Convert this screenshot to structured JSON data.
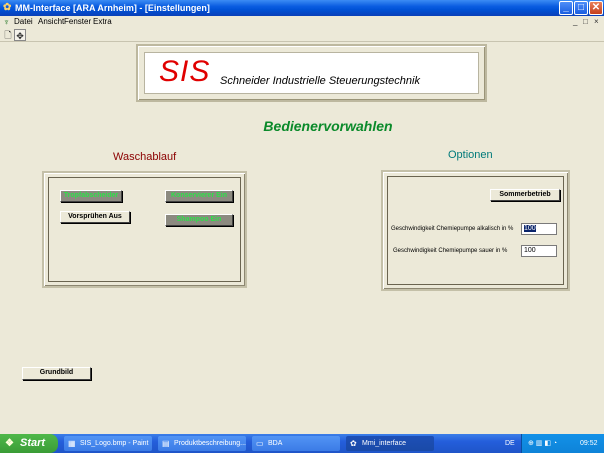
{
  "window": {
    "title": "MM-Interface [ARA Arnheim] - [Einstellungen]",
    "controls": {
      "minimize": "_",
      "maximize": "□",
      "close": "✕"
    }
  },
  "menu": {
    "items": [
      "Datei",
      "Ansicht",
      "Fenster",
      "Extra"
    ],
    "mdi_controls": [
      "_",
      "□",
      "×"
    ]
  },
  "toolbar": {
    "icons": [
      "new-document-icon",
      "navigate-icon"
    ]
  },
  "logo": {
    "brand": "SIS",
    "tagline": "Schneider Industrielle Steuerungstechnik",
    "brand_color": "#e00000"
  },
  "heading": "Bedienervorwahlen",
  "left_section": {
    "title": "Waschablauf",
    "buttons": {
      "tropfenabscheider": "Tropfabscheider",
      "vorspruehen": "Vorsprühen Aus",
      "konservierer": "Konservierer Ein",
      "shampoo": "Shampoo Ein"
    }
  },
  "right_section": {
    "title": "Optionen",
    "sommerbetrieb": "Sommerbetrieb",
    "fields": [
      {
        "label": "Geschwindigkeit Chemiepumpe alkalisch in %",
        "value": "100"
      },
      {
        "label": "Geschwindigkeit Chemiepumpe sauer in %",
        "value": "100"
      }
    ]
  },
  "grundbild_button": "Grundbild",
  "taskbar": {
    "start": "Start",
    "tasks": [
      {
        "label": "SIS_Logo.bmp - Paint",
        "icon": "paint-icon"
      },
      {
        "label": "Produktbeschreibung...",
        "icon": "word-icon"
      },
      {
        "label": "BDA",
        "icon": "folder-icon"
      },
      {
        "label": "Mmi_interface",
        "icon": "app-icon"
      }
    ],
    "language": "DE",
    "clock": "09:52"
  },
  "colors": {
    "heading_green": "#0a8a2a",
    "waschablauf_red": "#8b0000",
    "optionen_teal": "#007a7a",
    "active_button_text": "#2ee04a"
  }
}
